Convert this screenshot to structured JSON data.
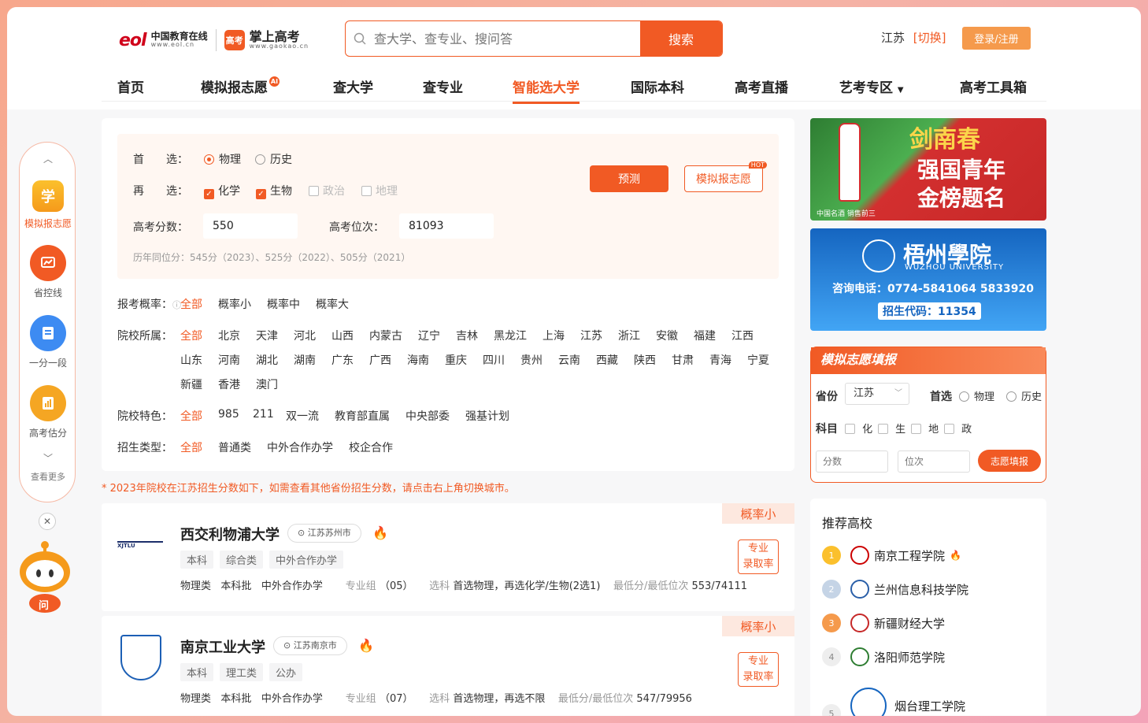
{
  "header": {
    "eol_mark": "eol",
    "eol_name": "中国教育在线",
    "eol_domain": "www.eol.cn",
    "gk_mark": "高考",
    "gk_name": "掌上高考",
    "gk_domain": "www.gaokao.cn",
    "search_placeholder": "查大学、查专业、搜问答",
    "search_button": "搜索",
    "province": "江苏",
    "switch_label": "[切换]",
    "login_label": "登录/注册"
  },
  "nav": [
    {
      "label": "首页"
    },
    {
      "label": "模拟报志愿",
      "badge": "AI"
    },
    {
      "label": "查大学"
    },
    {
      "label": "查专业"
    },
    {
      "label": "智能选大学"
    },
    {
      "label": "国际本科"
    },
    {
      "label": "高考直播"
    },
    {
      "label": "艺考专区"
    },
    {
      "label": "高考工具箱"
    }
  ],
  "sidebar": {
    "items": [
      {
        "label": "模拟报志愿",
        "icon_char": "学"
      },
      {
        "label": "省控线",
        "icon_char": "📈"
      },
      {
        "label": "一分一段",
        "icon_char": "☰"
      },
      {
        "label": "高考估分",
        "icon_char": "▥"
      }
    ],
    "more_label": "查看更多",
    "mascot_char": "问"
  },
  "filter": {
    "first_label": "首　　选：",
    "first_options": [
      "物理",
      "历史"
    ],
    "second_label": "再　　选：",
    "second_options": [
      "化学",
      "生物",
      "政治",
      "地理"
    ],
    "score_label": "高考分数：",
    "score_value": "550",
    "rank_label": "高考位次：",
    "rank_value": "81093",
    "history_hint": "历年同位分：545分（2023）、525分（2022）、505分（2021）",
    "predict_button": "预测",
    "simulate_button": "模拟报志愿",
    "hot_badge": "HOT"
  },
  "filters": {
    "prob_label": "报考概率：",
    "prob_options": [
      "全部",
      "概率小",
      "概率中",
      "概率大"
    ],
    "location_label": "院校所属：",
    "locations_row1": [
      "全部",
      "北京",
      "天津",
      "河北",
      "山西",
      "内蒙古",
      "辽宁",
      "吉林",
      "黑龙江",
      "上海",
      "江苏",
      "浙江",
      "安徽",
      "福建",
      "江西"
    ],
    "locations_row2": [
      "山东",
      "河南",
      "湖北",
      "湖南",
      "广东",
      "广西",
      "海南",
      "重庆",
      "四川",
      "贵州",
      "云南",
      "西藏",
      "陕西",
      "甘肃",
      "青海",
      "宁夏"
    ],
    "locations_row3": [
      "新疆",
      "香港",
      "澳门"
    ],
    "feature_label": "院校特色：",
    "features": [
      "全部",
      "985",
      "211",
      "双一流",
      "教育部直属",
      "中央部委",
      "强基计划"
    ],
    "type_label": "招生类型：",
    "types": [
      "全部",
      "普通类",
      "中外合作办学",
      "校企合作"
    ]
  },
  "notice": "* 2023年院校在江苏招生分数如下，如需查看其他省份招生分数，请点击右上角切换城市。",
  "colleges": [
    {
      "name": "西交利物浦大学",
      "location": "江苏苏州市",
      "prob": "概率小",
      "tags": [
        "本科",
        "综合类",
        "中外合作办学"
      ],
      "info_a": "物理类",
      "info_b": "本科批",
      "info_c": "中外合作办学",
      "group_label": "专业组",
      "group_value": "（05）",
      "subject_label": "选科",
      "subject_value": "首选物理，再选化学/生物(2选1)",
      "min_label": "最低分/最低位次",
      "min_value": "553/74111",
      "rate_button": "专业录取率"
    },
    {
      "name": "南京工业大学",
      "location": "江苏南京市",
      "prob": "概率小",
      "tags": [
        "本科",
        "理工类",
        "公办"
      ],
      "info_a": "物理类",
      "info_b": "本科批",
      "info_c": "中外合作办学",
      "group_label": "专业组",
      "group_value": "（07）",
      "subject_label": "选科",
      "subject_value": "首选物理，再选不限",
      "min_label": "最低分/最低位次",
      "min_value": "547/79956",
      "rate_button": "专业录取率"
    }
  ],
  "ads": {
    "ad1_title": "剑南春",
    "ad1_line1": "强国青年",
    "ad1_line2": "金榜题名",
    "ad1_foot": "中国名酒 销售前三",
    "ad2_title": "梧州學院",
    "ad2_en": "WUZHOU UNIVERSITY",
    "ad2_phone": "咨询电话：0774-5841064 5833920",
    "ad2_code": "招生代码：11354"
  },
  "sim_panel": {
    "title": "模拟志愿填报",
    "province_label": "省份",
    "province_value": "江苏",
    "first_label": "首选",
    "first_options": [
      "物理",
      "历史"
    ],
    "subject_label": "科目",
    "subjects": [
      "化",
      "生",
      "地",
      "政"
    ],
    "score_placeholder": "分数",
    "rank_placeholder": "位次",
    "submit": "志愿填报"
  },
  "recommend": {
    "title": "推荐高校",
    "items": [
      {
        "rank": "1",
        "name": "南京工程学院"
      },
      {
        "rank": "2",
        "name": "兰州信息科技学院"
      },
      {
        "rank": "3",
        "name": "新疆财经大学"
      },
      {
        "rank": "4",
        "name": "洛阳师范学院"
      },
      {
        "rank": "5",
        "name": "烟台理工学院"
      }
    ]
  },
  "colors": {
    "accent": "#f15a24",
    "secondary": "#f59a4c"
  }
}
